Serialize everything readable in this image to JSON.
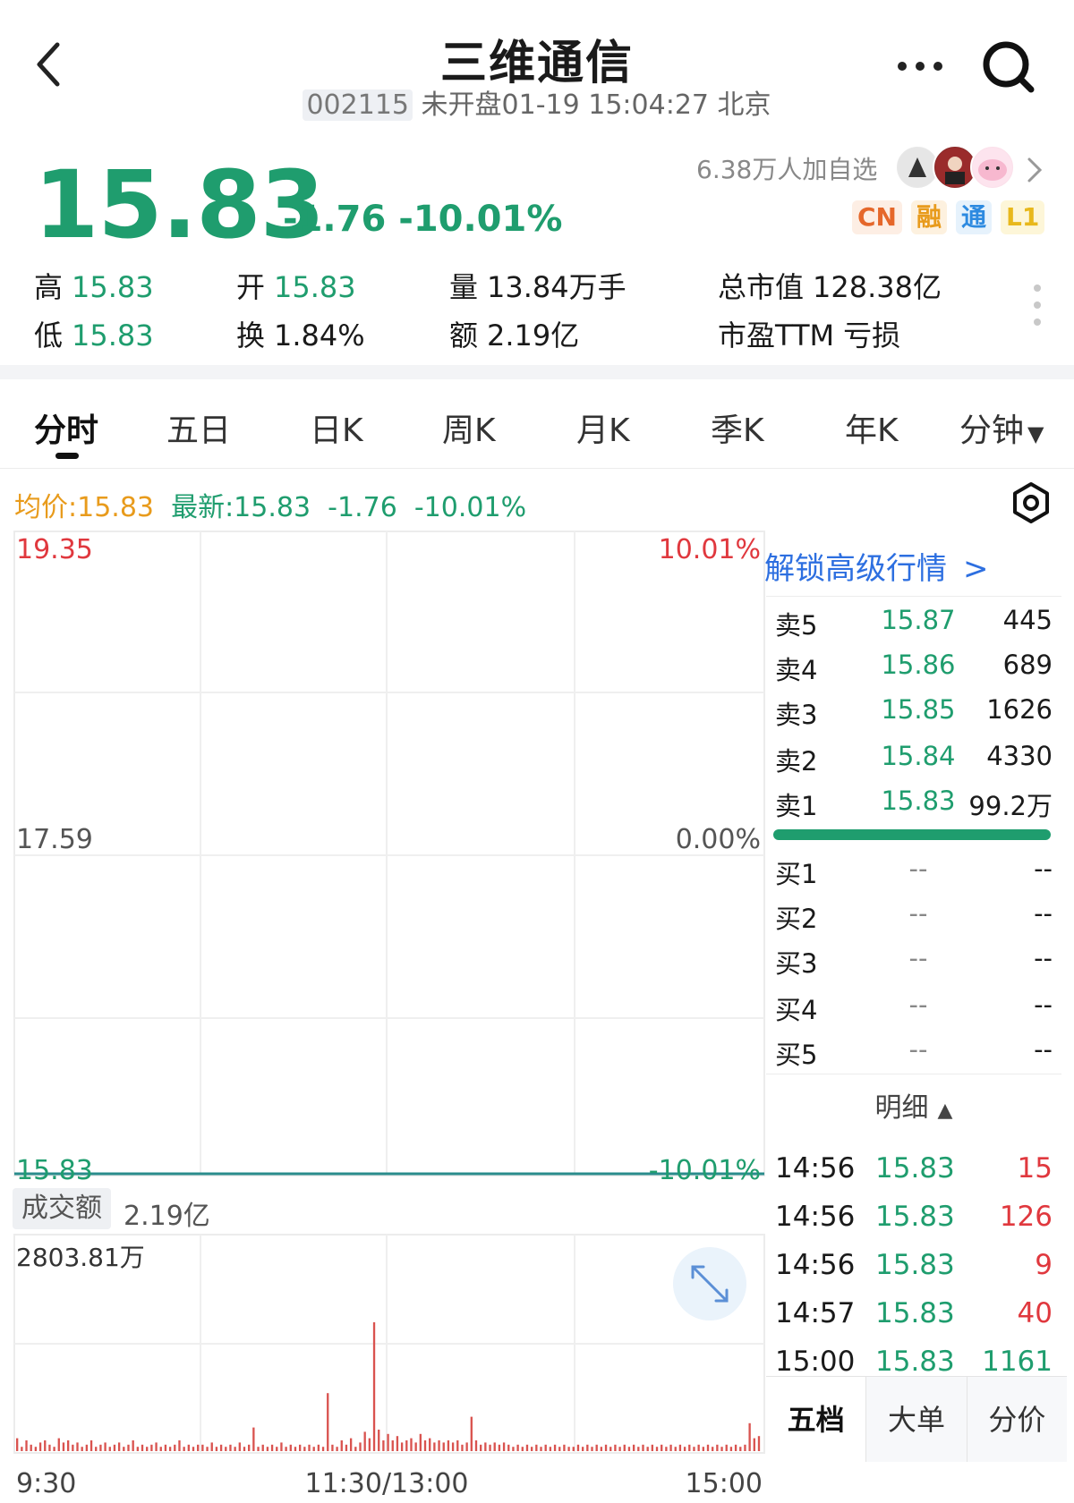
{
  "header": {
    "title": "三维通信",
    "code": "002115",
    "status": "未开盘01-19 15:04:27 北京"
  },
  "quote": {
    "price": "15.83",
    "change": "-1.76 -10.01%",
    "watchers": "6.38万人加自选",
    "badges": [
      "CN",
      "融",
      "通",
      "L1"
    ],
    "stats": [
      {
        "label": "高",
        "value": "15.83"
      },
      {
        "label": "开",
        "value": "15.83"
      },
      {
        "label": "量",
        "value": "13.84万手"
      },
      {
        "label": "总市值",
        "value": "128.38亿"
      },
      {
        "label": "低",
        "value": "15.83"
      },
      {
        "label": "换",
        "value": "1.84%"
      },
      {
        "label": "额",
        "value": "2.19亿"
      },
      {
        "label": "市盈TTM",
        "value": "亏损"
      }
    ]
  },
  "tabs": [
    "分时",
    "五日",
    "日K",
    "周K",
    "月K",
    "季K",
    "年K",
    "分钟"
  ],
  "info_line": {
    "avg": "均价:15.83",
    "latest": "最新:15.83",
    "change": "-1.76",
    "pct": "-10.01%"
  },
  "orderbook": {
    "unlock": "解锁高级行情",
    "sell": [
      {
        "label": "卖5",
        "price": "15.87",
        "vol": "445"
      },
      {
        "label": "卖4",
        "price": "15.86",
        "vol": "689"
      },
      {
        "label": "卖3",
        "price": "15.85",
        "vol": "1626"
      },
      {
        "label": "卖2",
        "price": "15.84",
        "vol": "4330"
      },
      {
        "label": "卖1",
        "price": "15.83",
        "vol": "99.2万"
      }
    ],
    "buy": [
      {
        "label": "买1",
        "price": "--",
        "vol": "--"
      },
      {
        "label": "买2",
        "price": "--",
        "vol": "--"
      },
      {
        "label": "买3",
        "price": "--",
        "vol": "--"
      },
      {
        "label": "买4",
        "price": "--",
        "vol": "--"
      },
      {
        "label": "买5",
        "price": "--",
        "vol": "--"
      }
    ],
    "detail_label": "明细",
    "trades": [
      {
        "time": "14:56",
        "price": "15.83",
        "vol": "15"
      },
      {
        "time": "14:56",
        "price": "15.83",
        "vol": "126"
      },
      {
        "time": "14:56",
        "price": "15.83",
        "vol": "9"
      },
      {
        "time": "14:57",
        "price": "15.83",
        "vol": "40"
      },
      {
        "time": "15:00",
        "price": "15.83",
        "vol": "1161"
      }
    ],
    "bottom_tabs": [
      "五档",
      "大单",
      "分价"
    ]
  },
  "chart_data": {
    "type": "line",
    "y_left_labels": [
      "19.35",
      "17.59",
      "15.83"
    ],
    "y_right_labels": [
      "10.01%",
      "0.00%",
      "-10.01%"
    ],
    "ylim": [
      15.83,
      19.35
    ],
    "x_labels": [
      "9:30",
      "11:30/13:00",
      "15:00"
    ],
    "series": [
      {
        "values": [
          15.83,
          15.83
        ]
      }
    ],
    "volume": {
      "label": "成交额",
      "value": "2.19亿",
      "max_label": "2803.81万",
      "bars": [
        0.06,
        0.02,
        0.05,
        0.03,
        0.02,
        0.04,
        0.05,
        0.03,
        0.02,
        0.06,
        0.04,
        0.05,
        0.03,
        0.04,
        0.02,
        0.03,
        0.05,
        0.02,
        0.03,
        0.04,
        0.02,
        0.03,
        0.04,
        0.02,
        0.03,
        0.05,
        0.02,
        0.03,
        0.02,
        0.03,
        0.04,
        0.02,
        0.03,
        0.02,
        0.03,
        0.05,
        0.02,
        0.03,
        0.02,
        0.03,
        0.03,
        0.02,
        0.04,
        0.02,
        0.03,
        0.02,
        0.03,
        0.02,
        0.04,
        0.02,
        0.03,
        0.11,
        0.02,
        0.03,
        0.02,
        0.03,
        0.02,
        0.04,
        0.02,
        0.03,
        0.02,
        0.03,
        0.02,
        0.03,
        0.02,
        0.03,
        0.02,
        0.27,
        0.03,
        0.02,
        0.05,
        0.03,
        0.06,
        0.02,
        0.04,
        0.09,
        0.06,
        0.6,
        0.1,
        0.05,
        0.08,
        0.05,
        0.07,
        0.04,
        0.05,
        0.06,
        0.04,
        0.08,
        0.05,
        0.06,
        0.04,
        0.05,
        0.04,
        0.05,
        0.04,
        0.05,
        0.03,
        0.04,
        0.16,
        0.05,
        0.03,
        0.04,
        0.03,
        0.04,
        0.03,
        0.04,
        0.03,
        0.02,
        0.03,
        0.02,
        0.03,
        0.02,
        0.03,
        0.02,
        0.03,
        0.02,
        0.03,
        0.02,
        0.03,
        0.02,
        0.02,
        0.03,
        0.02,
        0.03,
        0.02,
        0.03,
        0.02,
        0.03,
        0.02,
        0.03,
        0.02,
        0.03,
        0.02,
        0.03,
        0.02,
        0.03,
        0.02,
        0.03,
        0.02,
        0.03,
        0.02,
        0.03,
        0.02,
        0.03,
        0.02,
        0.03,
        0.02,
        0.03,
        0.02,
        0.03,
        0.02,
        0.03,
        0.02,
        0.03,
        0.02,
        0.03,
        0.02,
        0.03,
        0.13,
        0.06,
        0.07
      ]
    }
  },
  "colors": {
    "green": "#1f9d6e",
    "red": "#e0383e",
    "orange": "#e89b1c",
    "blue": "#2d6fe0"
  }
}
